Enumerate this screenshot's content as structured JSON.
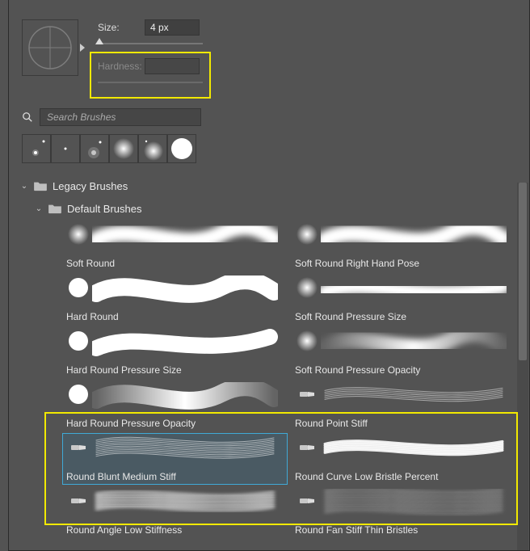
{
  "size": {
    "label": "Size:",
    "value": "4 px"
  },
  "hardness": {
    "label": "Hardness:",
    "value": ""
  },
  "search": {
    "placeholder": "Search Brushes"
  },
  "folders": {
    "root": "Legacy Brushes",
    "child": "Default Brushes"
  },
  "brushes": [
    {
      "name": "Soft Round",
      "icon": "soft",
      "stroke": "soft"
    },
    {
      "name": "Soft Round Right Hand Pose",
      "icon": "soft",
      "stroke": "soft"
    },
    {
      "name": "Hard Round",
      "icon": "hard",
      "stroke": "hard"
    },
    {
      "name": "Soft Round Pressure Size",
      "icon": "soft",
      "stroke": "softtaper"
    },
    {
      "name": "Hard Round Pressure Size",
      "icon": "hard",
      "stroke": "hardtaper"
    },
    {
      "name": "Soft Round Pressure Opacity",
      "icon": "soft",
      "stroke": "softfade"
    },
    {
      "name": "Hard Round Pressure Opacity",
      "icon": "hard",
      "stroke": "hardfade"
    },
    {
      "name": "Round Point Stiff",
      "icon": "bristle",
      "stroke": "bristle1"
    },
    {
      "name": "Round Blunt Medium Stiff",
      "icon": "bristle",
      "stroke": "bristle2",
      "selected": true
    },
    {
      "name": "Round Curve Low Bristle Percent",
      "icon": "bristle",
      "stroke": "bristle3"
    },
    {
      "name": "Round Angle Low Stiffness",
      "icon": "bristle",
      "stroke": "bristle4"
    },
    {
      "name": "Round Fan Stiff Thin Bristles",
      "icon": "bristle",
      "stroke": "bristle5"
    }
  ]
}
